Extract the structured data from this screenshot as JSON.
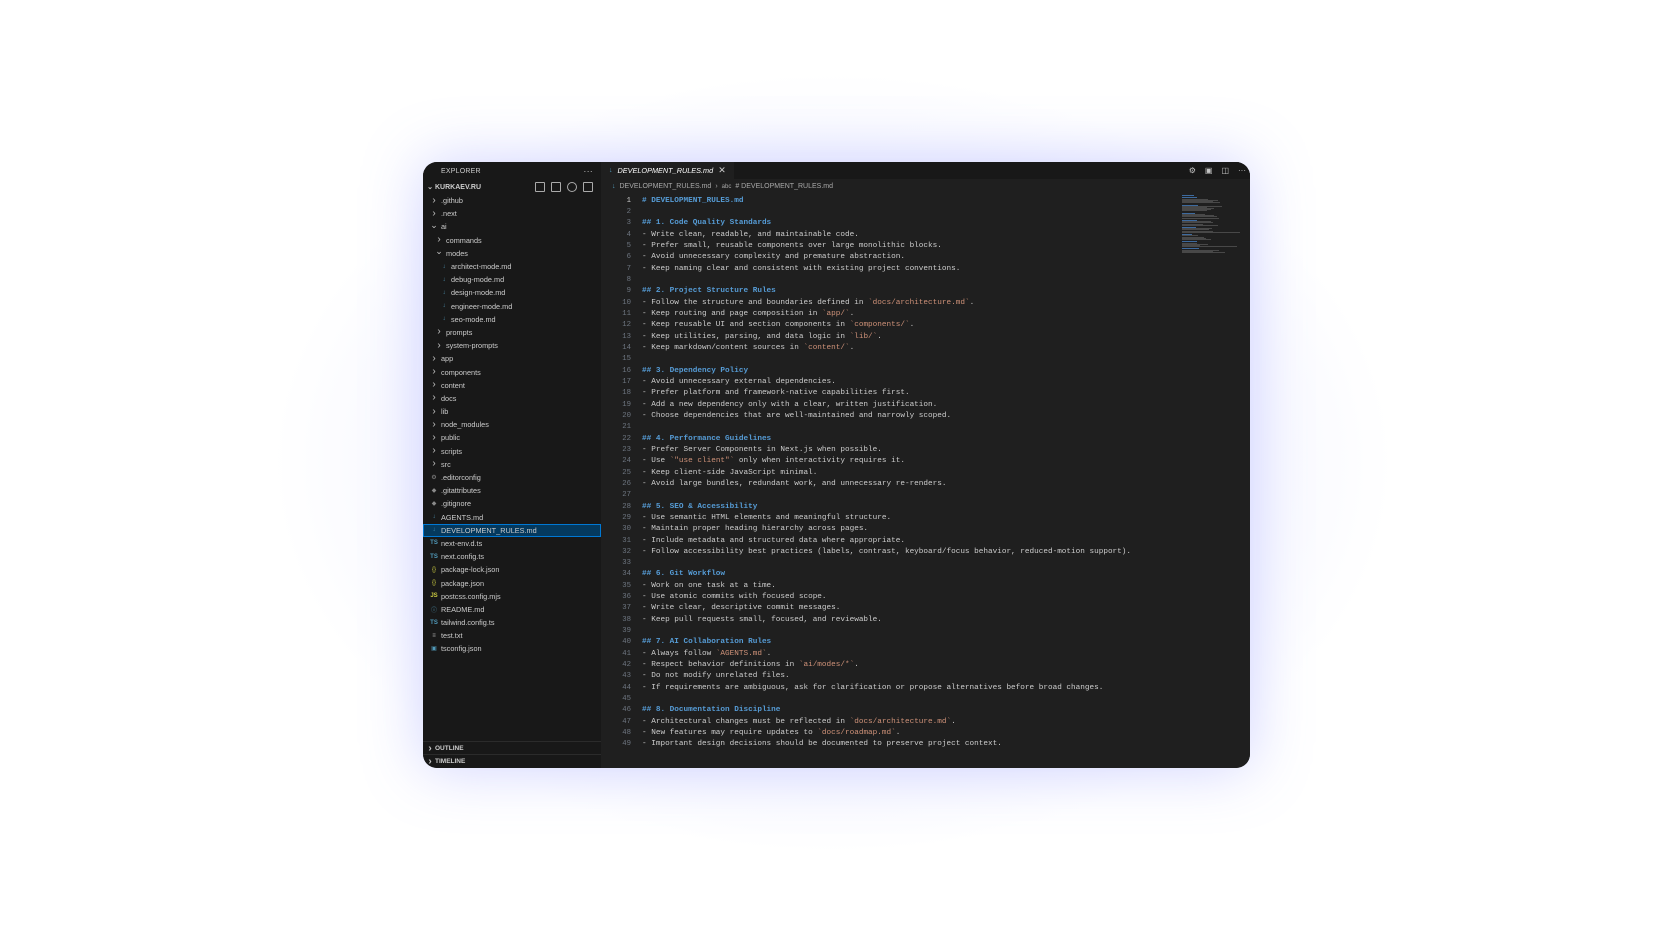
{
  "sidebar": {
    "header": "EXPLORER",
    "root": "KURKAEV.RU",
    "outline_label": "OUTLINE",
    "timeline_label": "TIMELINE",
    "items": [
      {
        "label": ".github",
        "icon": "chevron-right-icon"
      },
      {
        "label": ".next",
        "icon": "chevron-right-icon"
      },
      {
        "label": "ai",
        "icon": "chevron-down-icon"
      },
      {
        "label": "commands",
        "icon": "chevron-right-icon"
      },
      {
        "label": "modes",
        "icon": "chevron-down-icon"
      },
      {
        "label": "architect-mode.md",
        "icon": "markdown-icon"
      },
      {
        "label": "debug-mode.md",
        "icon": "markdown-icon"
      },
      {
        "label": "design-mode.md",
        "icon": "markdown-icon"
      },
      {
        "label": "engineer-mode.md",
        "icon": "markdown-icon"
      },
      {
        "label": "seo-mode.md",
        "icon": "markdown-icon"
      },
      {
        "label": "prompts",
        "icon": "chevron-right-icon"
      },
      {
        "label": "system-prompts",
        "icon": "chevron-right-icon"
      },
      {
        "label": "app",
        "icon": "chevron-right-icon"
      },
      {
        "label": "components",
        "icon": "chevron-right-icon"
      },
      {
        "label": "content",
        "icon": "chevron-right-icon"
      },
      {
        "label": "docs",
        "icon": "chevron-right-icon"
      },
      {
        "label": "lib",
        "icon": "chevron-right-icon"
      },
      {
        "label": "node_modules",
        "icon": "chevron-right-icon"
      },
      {
        "label": "public",
        "icon": "chevron-right-icon"
      },
      {
        "label": "scripts",
        "icon": "chevron-right-icon"
      },
      {
        "label": "src",
        "icon": "chevron-right-icon"
      },
      {
        "label": ".editorconfig",
        "icon": "gear-icon"
      },
      {
        "label": ".gitattributes",
        "icon": "git-icon"
      },
      {
        "label": ".gitignore",
        "icon": "git-icon"
      },
      {
        "label": "AGENTS.md",
        "icon": "markdown-icon"
      },
      {
        "label": "DEVELOPMENT_RULES.md",
        "icon": "markdown-icon"
      },
      {
        "label": "next-env.d.ts",
        "icon": "typescript-icon"
      },
      {
        "label": "next.config.ts",
        "icon": "typescript-icon"
      },
      {
        "label": "package-lock.json",
        "icon": "json-icon"
      },
      {
        "label": "package.json",
        "icon": "json-icon"
      },
      {
        "label": "postcss.config.mjs",
        "icon": "javascript-icon"
      },
      {
        "label": "README.md",
        "icon": "info-icon"
      },
      {
        "label": "tailwind.config.ts",
        "icon": "typescript-icon"
      },
      {
        "label": "test.txt",
        "icon": "text-file-icon"
      },
      {
        "label": "tsconfig.json",
        "icon": "tsconfig-icon"
      }
    ]
  },
  "editor": {
    "tab_label": "DEVELOPMENT_RULES.md",
    "breadcrumb": [
      "DEVELOPMENT_RULES.md",
      "# DEVELOPMENT_RULES.md"
    ],
    "active_line": 1,
    "lines": [
      "# DEVELOPMENT_RULES.md",
      "",
      "## 1. Code Quality Standards",
      "- Write clean, readable, and maintainable code.",
      "- Prefer small, reusable components over large monolithic blocks.",
      "- Avoid unnecessary complexity and premature abstraction.",
      "- Keep naming clear and consistent with existing project conventions.",
      "",
      "## 2. Project Structure Rules",
      "- Follow the structure and boundaries defined in `docs/architecture.md`.",
      "- Keep routing and page composition in `app/`.",
      "- Keep reusable UI and section components in `components/`.",
      "- Keep utilities, parsing, and data logic in `lib/`.",
      "- Keep markdown/content sources in `content/`.",
      "",
      "## 3. Dependency Policy",
      "- Avoid unnecessary external dependencies.",
      "- Prefer platform and framework-native capabilities first.",
      "- Add a new dependency only with a clear, written justification.",
      "- Choose dependencies that are well-maintained and narrowly scoped.",
      "",
      "## 4. Performance Guidelines",
      "- Prefer Server Components in Next.js when possible.",
      "- Use `\"use client\"` only when interactivity requires it.",
      "- Keep client-side JavaScript minimal.",
      "- Avoid large bundles, redundant work, and unnecessary re-renders.",
      "",
      "## 5. SEO & Accessibility",
      "- Use semantic HTML elements and meaningful structure.",
      "- Maintain proper heading hierarchy across pages.",
      "- Include metadata and structured data where appropriate.",
      "- Follow accessibility best practices (labels, contrast, keyboard/focus behavior, reduced-motion support).",
      "",
      "## 6. Git Workflow",
      "- Work on one task at a time.",
      "- Use atomic commits with focused scope.",
      "- Write clear, descriptive commit messages.",
      "- Keep pull requests small, focused, and reviewable.",
      "",
      "## 7. AI Collaboration Rules",
      "- Always follow `AGENTS.md`.",
      "- Respect behavior definitions in `ai/modes/*`.",
      "- Do not modify unrelated files.",
      "- If requirements are ambiguous, ask for clarification or propose alternatives before broad changes.",
      "",
      "## 8. Documentation Discipline",
      "- Architectural changes must be reflected in `docs/architecture.md`.",
      "- New features may require updates to `docs/roadmap.md`.",
      "- Important design decisions should be documented to preserve project context."
    ]
  }
}
